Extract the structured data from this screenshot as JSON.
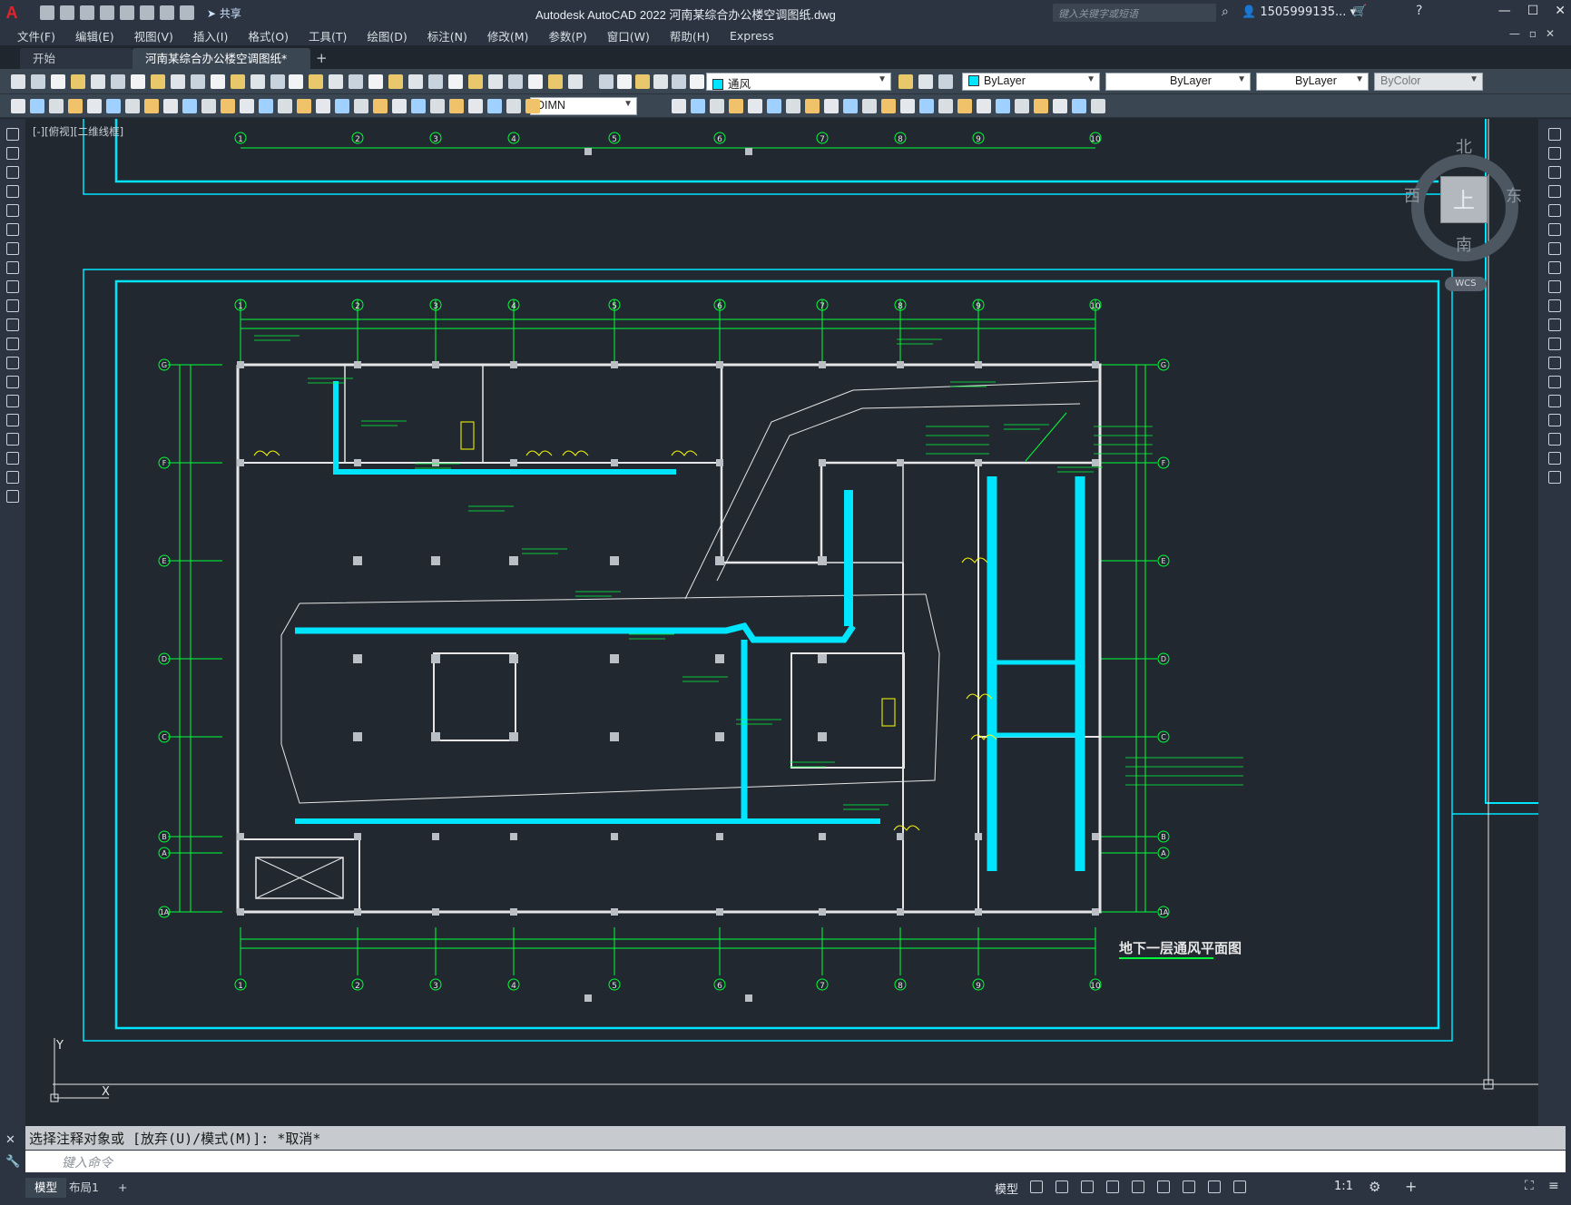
{
  "app": {
    "logo": "A",
    "window_title": "Autodesk AutoCAD 2022    河南某综合办公楼空调图纸.dwg",
    "share_label": "共享",
    "search_placeholder": "键入关键字或短语",
    "user": "1505999135...",
    "help": "?"
  },
  "menu": [
    "文件(F)",
    "编辑(E)",
    "视图(V)",
    "插入(I)",
    "格式(O)",
    "工具(T)",
    "绘图(D)",
    "标注(N)",
    "修改(M)",
    "参数(P)",
    "窗口(W)",
    "帮助(H)",
    "Express"
  ],
  "tabs": {
    "start": "开始",
    "active": "河南某综合办公楼空调图纸*",
    "close": "✕",
    "add": "+"
  },
  "toolbar": {
    "layer": "通风",
    "color": "ByLayer",
    "linetype": "ByLayer",
    "lineweight": "ByLayer",
    "plotstyle": "ByColor",
    "dimstyle": "DIMN"
  },
  "colors": {
    "ui_dark": "#2b3440",
    "canvas": "#212830",
    "cyan": "#00e5ff",
    "green": "#00ff3a",
    "yellow": "#ffff00",
    "white": "#e6e6e6",
    "layer_swatch": "#00e5ff"
  },
  "viewport": {
    "label": "[-][俯视][二维线框]",
    "viewcube": {
      "top": "上",
      "north": "北",
      "south": "南",
      "east": "东",
      "west": "西",
      "wcs": "WCS"
    },
    "ucs": {
      "x": "X",
      "y": "Y"
    }
  },
  "drawing": {
    "title": "地下一层通风平面图",
    "axes_numbers": [
      "1",
      "2",
      "3",
      "4",
      "5",
      "6",
      "7",
      "8",
      "9",
      "10"
    ],
    "axes_letters": [
      "G",
      "F",
      "E",
      "D",
      "C",
      "B",
      "A",
      "1A"
    ]
  },
  "command": {
    "history": "选择注释对象或 [放弃(U)/模式(M)]: *取消*",
    "placeholder": "键入命令"
  },
  "status": {
    "model_tab": "模型",
    "layout_tab": "布局1",
    "add": "+",
    "model": "模型",
    "scale": "1:1"
  },
  "icons": [
    "new-icon",
    "open-icon",
    "save-icon",
    "saveas-icon",
    "plot-icon",
    "undo-icon",
    "redo-icon",
    "share-icon",
    "search-icon",
    "user-icon",
    "cart-icon",
    "help-icon",
    "minimize-icon",
    "maximize-icon",
    "close-icon",
    "pan-icon",
    "zoom-icon",
    "layer-icon",
    "line-icon",
    "polyline-icon",
    "circle-icon",
    "arc-icon",
    "rectangle-icon",
    "hatch-icon",
    "text-icon",
    "move-icon",
    "rotate-icon",
    "scale-icon",
    "trim-icon",
    "settings-icon",
    "fullscreen-icon"
  ]
}
